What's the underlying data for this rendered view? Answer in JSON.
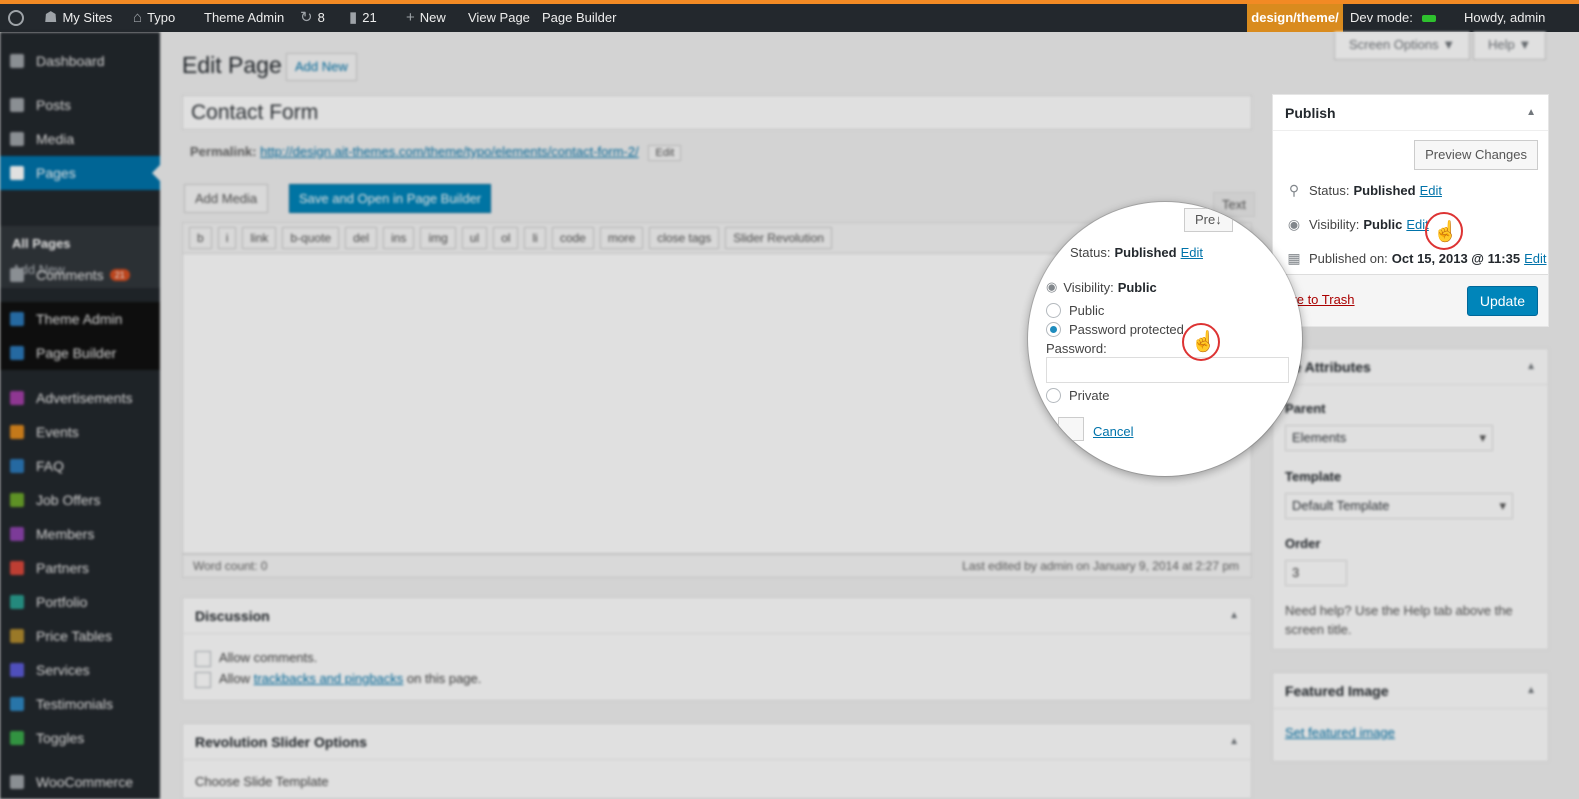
{
  "adminbar": {
    "my_sites": "My Sites",
    "site": "Typo",
    "theme_admin": "Theme Admin",
    "updates": "8",
    "comments": "21",
    "new": "New",
    "view_page": "View Page",
    "page_builder": "Page Builder",
    "dev_path": "design/theme/",
    "dev_mode": "Dev mode:",
    "howdy": "Howdy, admin"
  },
  "menu": {
    "items": [
      "Dashboard",
      "Posts",
      "Media",
      "Pages",
      "Comments",
      "Theme Admin",
      "Page Builder",
      "Advertisements",
      "Events",
      "FAQ",
      "Job Offers",
      "Members",
      "Partners",
      "Portfolio",
      "Price Tables",
      "Services",
      "Testimonials",
      "Toggles",
      "WooCommerce"
    ],
    "comments_badge": "21",
    "submenu": [
      "All Pages",
      "Add New"
    ]
  },
  "screen_options": "Screen Options ▼",
  "help": "Help ▼",
  "page": {
    "heading": "Edit Page",
    "add_new": "Add New",
    "title_value": "Contact Form",
    "permalink_label": "Permalink:",
    "permalink_url": "http://design.ait-themes.com/theme/typo/elements/contact-form-2/",
    "permalink_edit": "Edit",
    "add_media": "Add Media",
    "save_open_builder": "Save and Open in Page Builder",
    "tab_text": "Text",
    "quicktags": [
      "b",
      "i",
      "link",
      "b-quote",
      "del",
      "ins",
      "img",
      "ul",
      "ol",
      "li",
      "code",
      "more",
      "close tags",
      "Slider Revolution"
    ],
    "word_count": "Word count: 0",
    "last_edited": "Last edited by admin on January 9, 2014 at 2:27 pm"
  },
  "discussion": {
    "title": "Discussion",
    "allow_comments": "Allow comments.",
    "allow_pre": "Allow",
    "allow_link": "trackbacks and pingbacks",
    "allow_post": "on this page."
  },
  "revslider": {
    "title": "Revolution Slider Options",
    "choose": "Choose Slide Template"
  },
  "publish": {
    "title": "Publish",
    "preview": "Preview Changes",
    "status_label": "Status:",
    "status_value": "Published",
    "visibility_label": "Visibility:",
    "visibility_value": "Public",
    "published_label": "Published on:",
    "published_value": "Oct 15, 2013 @ 11:35",
    "edit": "Edit",
    "trash": "ove to Trash",
    "update": "Update"
  },
  "attributes": {
    "title": "ge Attributes",
    "parent_label": "Parent",
    "parent_value": "Elements",
    "template_label": "Template",
    "template_value": "Default Template",
    "order_label": "Order",
    "order_value": "3",
    "help": "Need help? Use the Help tab above the screen title."
  },
  "featured": {
    "title": "Featured Image",
    "set": "Set featured image"
  },
  "magnifier": {
    "preview_partial": "Pre↓",
    "status_label": "Status:",
    "status_value": "Published",
    "edit": "Edit",
    "visibility_label": "Visibility:",
    "visibility_value": "Public",
    "opt_public": "Public",
    "opt_password": "Password protected",
    "password_label": "Password:",
    "opt_private": "Private",
    "cancel": "Cancel"
  }
}
